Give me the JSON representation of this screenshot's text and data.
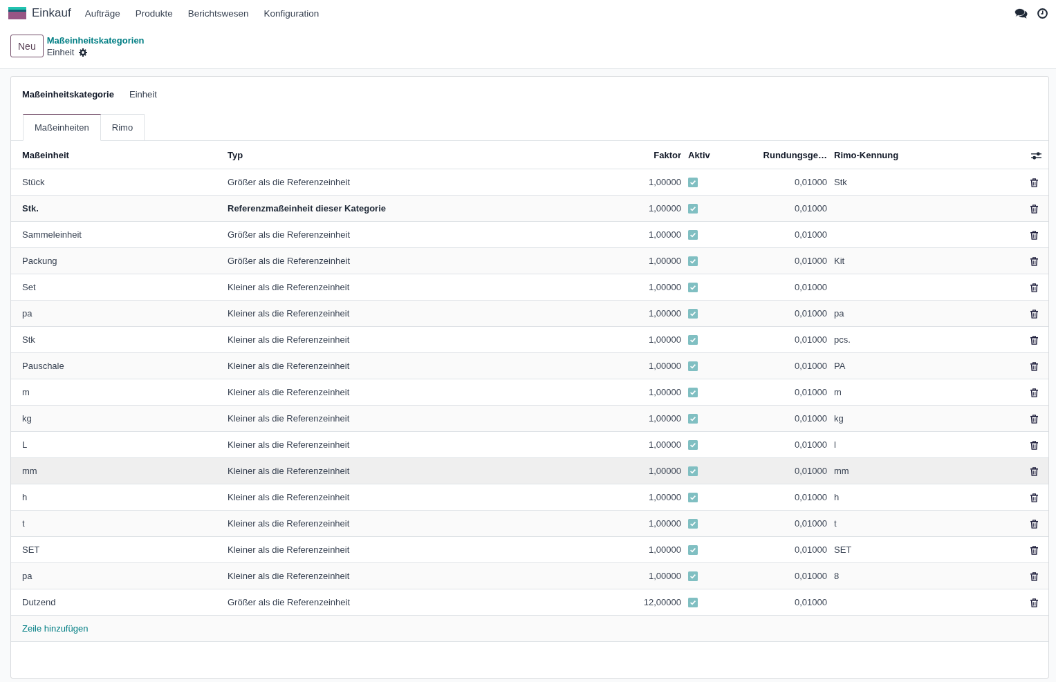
{
  "navbar": {
    "app_name": "Einkauf",
    "menu": [
      "Aufträge",
      "Produkte",
      "Berichtswesen",
      "Konfiguration"
    ]
  },
  "control_panel": {
    "new_button": "Neu",
    "breadcrumb": {
      "parent": "Maßeinheitskategorien",
      "current": "Einheit"
    }
  },
  "form": {
    "field_label": "Maßeinheitskategorie",
    "field_value": "Einheit",
    "tabs": [
      {
        "label": "Maßeinheiten",
        "selected": true
      },
      {
        "label": "Rimo",
        "selected": false
      }
    ],
    "table": {
      "columns": [
        "Maßeinheit",
        "Typ",
        "Faktor",
        "Aktiv",
        "Rundungsge…",
        "Rimo-Kennung"
      ],
      "rows": [
        {
          "unit": "Stück",
          "type": "Größer als die Referenzeinheit",
          "factor": "1,00000",
          "active": true,
          "rounding": "0,01000",
          "rimo_id": "Stk",
          "reference": false,
          "hovered": false
        },
        {
          "unit": "Stk.",
          "type": "Referenzmaßeinheit dieser Kategorie",
          "factor": "1,00000",
          "active": true,
          "rounding": "0,01000",
          "reference": true,
          "hovered": false
        },
        {
          "unit": "Sammeleinheit",
          "type": "Größer als die Referenzeinheit",
          "factor": "1,00000",
          "active": true,
          "rounding": "0,01000",
          "reference": false,
          "hovered": false
        },
        {
          "unit": "Packung",
          "type": "Größer als die Referenzeinheit",
          "factor": "1,00000",
          "active": true,
          "rounding": "0,01000",
          "rimo_id": "Kit",
          "reference": false,
          "hovered": false
        },
        {
          "unit": "Set",
          "type": "Kleiner als die Referenzeinheit",
          "factor": "1,00000",
          "active": true,
          "rounding": "0,01000",
          "reference": false,
          "hovered": false
        },
        {
          "unit": "pa",
          "type": "Kleiner als die Referenzeinheit",
          "factor": "1,00000",
          "active": true,
          "rounding": "0,01000",
          "rimo_id": "pa",
          "reference": false,
          "hovered": false
        },
        {
          "unit": "Stk",
          "type": "Kleiner als die Referenzeinheit",
          "factor": "1,00000",
          "active": true,
          "rounding": "0,01000",
          "rimo_id": "pcs.",
          "reference": false,
          "hovered": false
        },
        {
          "unit": "Pauschale",
          "type": "Kleiner als die Referenzeinheit",
          "factor": "1,00000",
          "active": true,
          "rounding": "0,01000",
          "rimo_id": "PA",
          "reference": false,
          "hovered": false
        },
        {
          "unit": "m",
          "type": "Kleiner als die Referenzeinheit",
          "factor": "1,00000",
          "active": true,
          "rounding": "0,01000",
          "rimo_id": "m",
          "reference": false,
          "hovered": false
        },
        {
          "unit": "kg",
          "type": "Kleiner als die Referenzeinheit",
          "factor": "1,00000",
          "active": true,
          "rounding": "0,01000",
          "rimo_id": "kg",
          "reference": false,
          "hovered": false
        },
        {
          "unit": "L",
          "type": "Kleiner als die Referenzeinheit",
          "factor": "1,00000",
          "active": true,
          "rounding": "0,01000",
          "rimo_id": "l",
          "reference": false,
          "hovered": false
        },
        {
          "unit": "mm",
          "type": "Kleiner als die Referenzeinheit",
          "factor": "1,00000",
          "active": true,
          "rounding": "0,01000",
          "rimo_id": "mm",
          "reference": false,
          "hovered": true
        },
        {
          "unit": "h",
          "type": "Kleiner als die Referenzeinheit",
          "factor": "1,00000",
          "active": true,
          "rounding": "0,01000",
          "rimo_id": "h",
          "reference": false,
          "hovered": false
        },
        {
          "unit": "t",
          "type": "Kleiner als die Referenzeinheit",
          "factor": "1,00000",
          "active": true,
          "rounding": "0,01000",
          "rimo_id": "t",
          "reference": false,
          "hovered": false
        },
        {
          "unit": "SET",
          "type": "Kleiner als die Referenzeinheit",
          "factor": "1,00000",
          "active": true,
          "rounding": "0,01000",
          "rimo_id": "SET",
          "reference": false,
          "hovered": false
        },
        {
          "unit": "pa",
          "type": "Kleiner als die Referenzeinheit",
          "factor": "1,00000",
          "active": true,
          "rounding": "0,01000",
          "rimo_id": "8",
          "reference": false,
          "hovered": false
        },
        {
          "unit": "Dutzend",
          "type": "Größer als die Referenzeinheit",
          "factor": "12,00000",
          "active": true,
          "rounding": "0,01000",
          "reference": false,
          "hovered": false
        }
      ],
      "add_line": "Zeile hinzufügen"
    }
  }
}
